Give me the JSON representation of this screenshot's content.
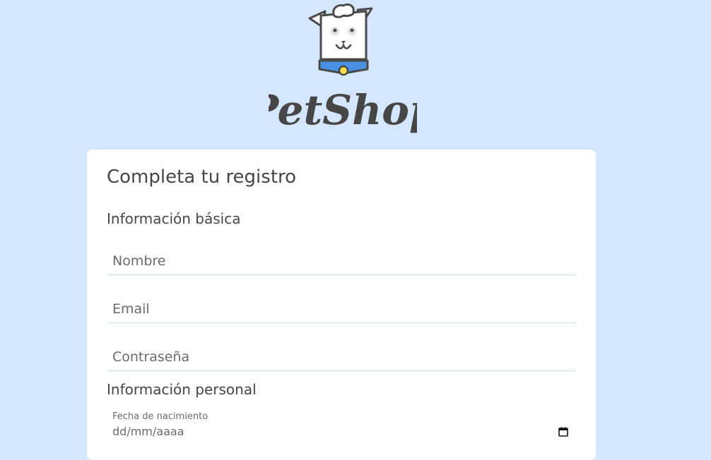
{
  "brand": {
    "name": "PetShop"
  },
  "form": {
    "title": "Completa tu registro",
    "basic_section": "Información básica",
    "personal_section": "Información personal",
    "name_placeholder": "Nombre",
    "email_placeholder": "Email",
    "password_placeholder": "Contraseña",
    "birthdate_label": "Fecha de nacimiento",
    "birthdate_placeholder": "dd/mm/aaaa"
  },
  "icons": {
    "logo": "dog-logo-icon",
    "calendar": "calendar-icon"
  },
  "colors": {
    "page_background": "#d4e7fe",
    "card_background": "#ffffff",
    "text": "#464646",
    "field_underline": "#c5e6ee",
    "collar_blue": "#4a90e2",
    "collar_tag": "#ffe14a"
  }
}
